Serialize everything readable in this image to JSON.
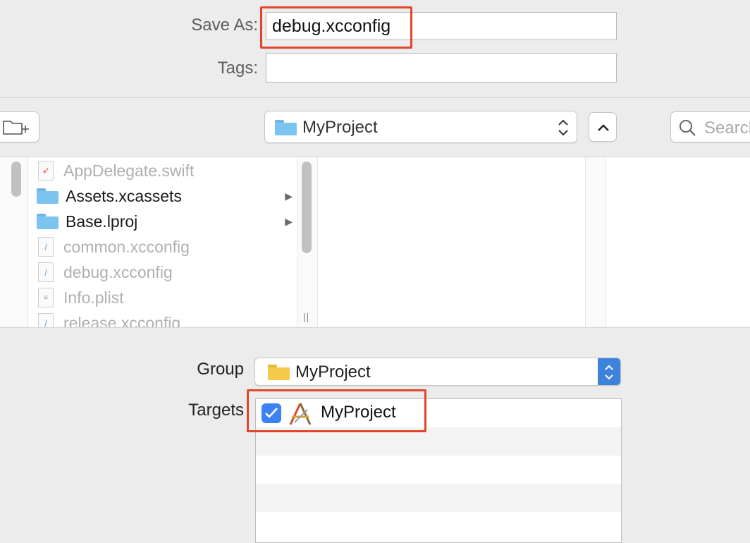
{
  "save_as": {
    "label": "Save As:",
    "value": "debug.xcconfig"
  },
  "tags": {
    "label": "Tags:",
    "value": ""
  },
  "toolbar": {
    "new_folder_icon": "new-folder-icon",
    "location": "MyProject",
    "search_placeholder": "Search"
  },
  "files": [
    {
      "name": "AppDelegate.swift",
      "icon": "swift-file-icon",
      "enabled": false,
      "has_children": false
    },
    {
      "name": "Assets.xcassets",
      "icon": "folder-icon",
      "enabled": true,
      "has_children": true
    },
    {
      "name": "Base.lproj",
      "icon": "folder-icon",
      "enabled": true,
      "has_children": true
    },
    {
      "name": "common.xcconfig",
      "icon": "xcconfig-file-icon",
      "enabled": false,
      "has_children": false
    },
    {
      "name": "debug.xcconfig",
      "icon": "xcconfig-file-icon",
      "enabled": false,
      "has_children": false
    },
    {
      "name": "Info.plist",
      "icon": "plist-file-icon",
      "enabled": false,
      "has_children": false
    },
    {
      "name": "release.xcconfig",
      "icon": "xcconfig-file-icon",
      "enabled": false,
      "has_children": false
    }
  ],
  "group": {
    "label": "Group",
    "value": "MyProject"
  },
  "targets": {
    "label": "Targets",
    "items": [
      {
        "name": "MyProject",
        "checked": true
      }
    ]
  },
  "colors": {
    "highlight_box": "#e0472a",
    "checkbox": "#3b82f6",
    "folder_blue": "#7cc4f0",
    "folder_yellow": "#f5c94a"
  }
}
